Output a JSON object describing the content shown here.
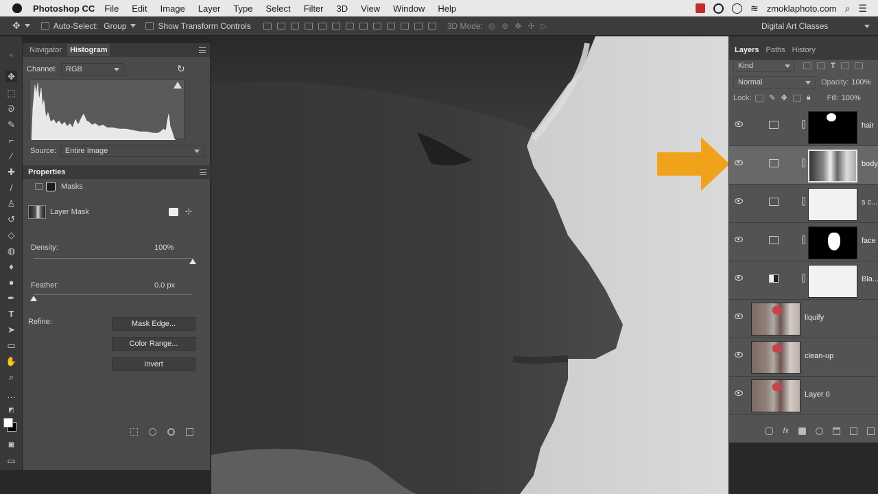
{
  "menubar": {
    "app_name": "Photoshop CC",
    "items": [
      "File",
      "Edit",
      "Image",
      "Layer",
      "Type",
      "Select",
      "Filter",
      "3D",
      "View",
      "Window",
      "Help"
    ],
    "domain": "zmoklaphoto.com"
  },
  "options_bar": {
    "auto_select_label": "Auto-Select:",
    "auto_select_value": "Group",
    "show_transform_label": "Show Transform Controls",
    "mode_3d_label": "3D Mode:",
    "workspace": "Digital Art Classes"
  },
  "histogram_panel": {
    "tabs": [
      "Navigator",
      "Histogram"
    ],
    "active_tab": "Histogram",
    "channel_label": "Channel:",
    "channel_value": "RGB",
    "source_label": "Source:",
    "source_value": "Entire Image"
  },
  "properties_panel": {
    "title": "Properties",
    "section": "Masks",
    "mask_label": "Layer Mask",
    "density_label": "Density:",
    "density_value": "100%",
    "density_level": 1.0,
    "feather_label": "Feather:",
    "feather_value": "0.0 px",
    "feather_level": 0.0,
    "refine_label": "Refine:",
    "buttons": [
      "Mask Edge...",
      "Color Range...",
      "Invert"
    ]
  },
  "layers_panel": {
    "tabs": [
      "Layers",
      "Paths",
      "History"
    ],
    "active_tab": "Layers",
    "filter_value": "Kind",
    "blend_mode": "Normal",
    "opacity_label": "Opacity:",
    "opacity_value": "100%",
    "lock_label": "Lock:",
    "fill_label": "Fill:",
    "fill_value": "100%",
    "layers": [
      {
        "name": "hair",
        "type": "adjustment",
        "selected": false
      },
      {
        "name": "body",
        "type": "adjustment",
        "selected": true
      },
      {
        "name": "s c...",
        "type": "adjustment",
        "selected": false
      },
      {
        "name": "face",
        "type": "adjustment",
        "selected": false
      },
      {
        "name": "Bla...",
        "type": "black-white",
        "selected": false
      },
      {
        "name": "liquify",
        "type": "pixel",
        "selected": false
      },
      {
        "name": "clean-up",
        "type": "pixel",
        "selected": false
      },
      {
        "name": "Layer 0",
        "type": "pixel",
        "selected": false
      }
    ]
  },
  "colors": {
    "arrow": "#f0a31a",
    "panel_bg": "#4a4a4a",
    "menubar_bg": "#e8e8e8"
  }
}
